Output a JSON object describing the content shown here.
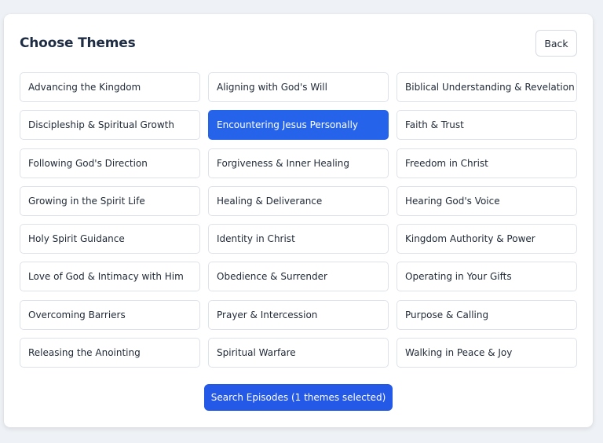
{
  "header": {
    "title": "Choose Themes",
    "back_label": "Back"
  },
  "themes": [
    {
      "label": "Advancing the Kingdom",
      "selected": false
    },
    {
      "label": "Aligning with God's Will",
      "selected": false
    },
    {
      "label": "Biblical Understanding & Revelation",
      "selected": false
    },
    {
      "label": "Discipleship & Spiritual Growth",
      "selected": false
    },
    {
      "label": "Encountering Jesus Personally",
      "selected": true
    },
    {
      "label": "Faith & Trust",
      "selected": false
    },
    {
      "label": "Following God's Direction",
      "selected": false
    },
    {
      "label": "Forgiveness & Inner Healing",
      "selected": false
    },
    {
      "label": "Freedom in Christ",
      "selected": false
    },
    {
      "label": "Growing in the Spirit Life",
      "selected": false
    },
    {
      "label": "Healing & Deliverance",
      "selected": false
    },
    {
      "label": "Hearing God's Voice",
      "selected": false
    },
    {
      "label": "Holy Spirit Guidance",
      "selected": false
    },
    {
      "label": "Identity in Christ",
      "selected": false
    },
    {
      "label": "Kingdom Authority & Power",
      "selected": false
    },
    {
      "label": "Love of God & Intimacy with Him",
      "selected": false
    },
    {
      "label": "Obedience & Surrender",
      "selected": false
    },
    {
      "label": "Operating in Your Gifts",
      "selected": false
    },
    {
      "label": "Overcoming Barriers",
      "selected": false
    },
    {
      "label": "Prayer & Intercession",
      "selected": false
    },
    {
      "label": "Purpose & Calling",
      "selected": false
    },
    {
      "label": "Releasing the Anointing",
      "selected": false
    },
    {
      "label": "Spiritual Warfare",
      "selected": false
    },
    {
      "label": "Walking in Peace & Joy",
      "selected": false
    }
  ],
  "footer": {
    "search_label": "Search Episodes (1 themes selected)"
  },
  "colors": {
    "accent": "#2563eb",
    "title": "#1f2d44",
    "border": "#dde2ea",
    "background": "#eef1f5"
  }
}
